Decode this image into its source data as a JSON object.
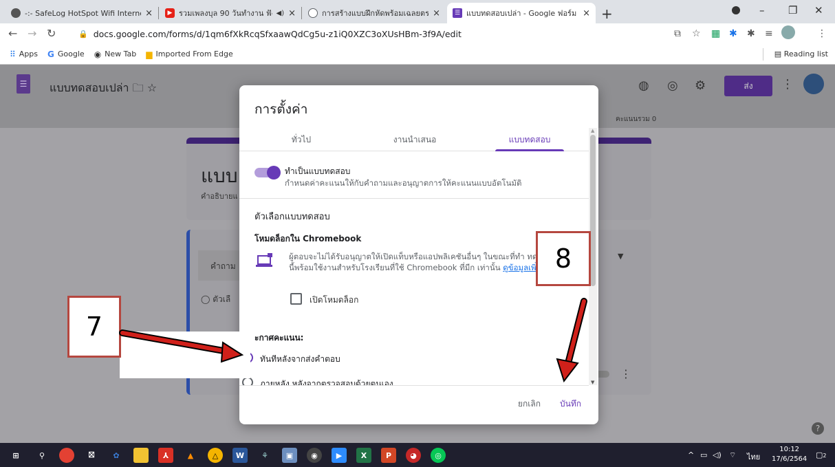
{
  "browser": {
    "tabs": [
      {
        "title": "-:- SafeLog HotSpot Wifi Internet"
      },
      {
        "title": "รวมเพลงบุล 90 วันทำงาน ฟังกันแ"
      },
      {
        "title": "การสร้างแบบฝึกหัดพร้อมเฉลยตรวจอัตโนมั"
      },
      {
        "title": "แบบทดสอบเปล่า - Google ฟอร์ม"
      }
    ],
    "url": "docs.google.com/forms/d/1qm6fXkRcqSfxaawQdCg5u-z1iQ0XZC3oXUsHBm-3f9A/edit",
    "bookmarks": [
      "Apps",
      "Google",
      "New Tab",
      "Imported From Edge"
    ],
    "reading_list": "Reading list"
  },
  "form": {
    "title": "แบบทดสอบเปล่า",
    "send_label": "ส่ง",
    "score_total": "คะแนนรวม 0",
    "card_title": "แบบ",
    "card_desc": "คำอธิบายแ",
    "question_placeholder": "คำถาม",
    "option_label": "ตัวเลื"
  },
  "dialog": {
    "title": "การตั้งค่า",
    "tabs": [
      "ทั่วไป",
      "งานนำเสนอ",
      "แบบทดสอบ"
    ],
    "make_quiz_label": "ทำเป็นแบบทดสอบ",
    "make_quiz_sub": "กำหนดค่าคะแนนให้กับคำถามและอนุญาตการให้คะแนนแบบอัตโนมัติ",
    "quiz_options_heading": "ตัวเลือกแบบทดสอบ",
    "locked_mode_heading": "โหมดล็อกใน Chromebook",
    "locked_mode_desc": "ผู้ตอบจะไม่ได้รับอนุญาตให้เปิดแท็บหรือแอปพลิเคชันอื่นๆ ในขณะที่ทำ ทดสอบนี้ ฟีเจอร์นี้พร้อมใช้งานสำหรับโรงเรียนที่ใช้ Chromebook ที่มีก เท่านั้น",
    "learn_more": "ดูข้อมูลเพิ่มเติม",
    "locked_mode_checkbox": "เปิดโหมดล็อก",
    "release_heading": "ะกาศคะแนน:",
    "release_options": [
      "ทันทีหลังจากส่งคำตอบ",
      "ภายหลัง หลังจากตรวจสอบด้วยตนเอง"
    ],
    "cancel_label": "ยกเลิก",
    "save_label": "บันทึก"
  },
  "annotations": {
    "step_left": "7",
    "step_right": "8",
    "arrow_color": "#d0201a"
  },
  "taskbar": {
    "time": "10:12",
    "date": "17/6/2564",
    "lang": "ไทย",
    "notifications": "2"
  }
}
